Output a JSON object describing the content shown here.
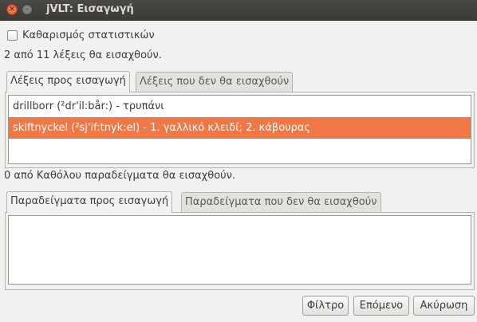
{
  "window": {
    "title": "jVLT: Εισαγωγή",
    "close_glyph": "✕",
    "minimize_glyph": "–"
  },
  "statistics_checkbox": {
    "label": "Καθαρισμός στατιστικών",
    "checked": false
  },
  "words_info": "2 από 11 λέξεις θα εισαχθούν.",
  "word_tabs": [
    {
      "label": "Λέξεις προς εισαγωγή",
      "active": true
    },
    {
      "label": "Λέξεις που δεν θα εισαχθούν",
      "active": false
    }
  ],
  "word_list": [
    {
      "text": "drillborr (²dr'il:bår:) - τρυπάνι",
      "selected": false
    },
    {
      "text": "skiftnyckel (²sj'if:tnyk:el) - 1.  γαλλικό κλειδί; 2. κάβουρας",
      "selected": true
    }
  ],
  "examples_info": "0 από Καθόλου παραδείγματα θα εισαχθούν.",
  "example_tabs": [
    {
      "label": "Παραδείγματα προς εισαγωγή",
      "active": true
    },
    {
      "label": "Παραδείγματα που δεν θα εισαχθούν",
      "active": false
    }
  ],
  "example_list": [],
  "buttons": {
    "filter": "Φίλτρο",
    "next": "Επόμενο",
    "cancel": "Ακύρωση"
  },
  "colors": {
    "selection": "#f07746",
    "titlebar": "#3c3b37",
    "window_bg": "#f2f1f0"
  }
}
